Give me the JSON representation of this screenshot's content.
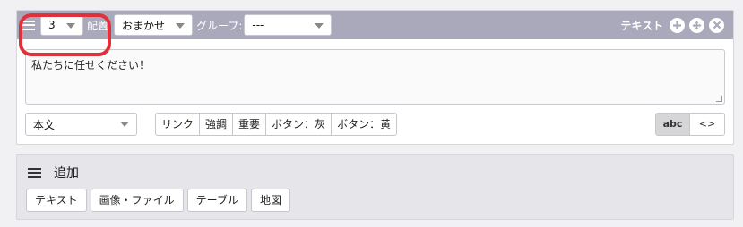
{
  "block": {
    "number_value": "3",
    "position_label": "配置:",
    "position_value": "おまかせ",
    "group_label": "グループ:",
    "group_value": "---",
    "type_label": "テキスト",
    "actions": [
      "add-icon",
      "move-icon",
      "close-icon"
    ],
    "body_text": "私たちに任せください！",
    "style_value": "本文",
    "format_buttons": [
      "リンク",
      "強調",
      "重要",
      "ボタン：灰",
      "ボタン：黄"
    ],
    "mode_buttons": [
      "abc",
      "<>"
    ],
    "active_mode": "abc"
  },
  "add_panel": {
    "title": "追加",
    "buttons": [
      "テキスト",
      "画像・ファイル",
      "テーブル",
      "地図"
    ]
  },
  "colors": {
    "header_bg": "#a9a9bb",
    "highlight_ring": "#e0313a",
    "add_panel_bg": "#e5e5ea"
  }
}
